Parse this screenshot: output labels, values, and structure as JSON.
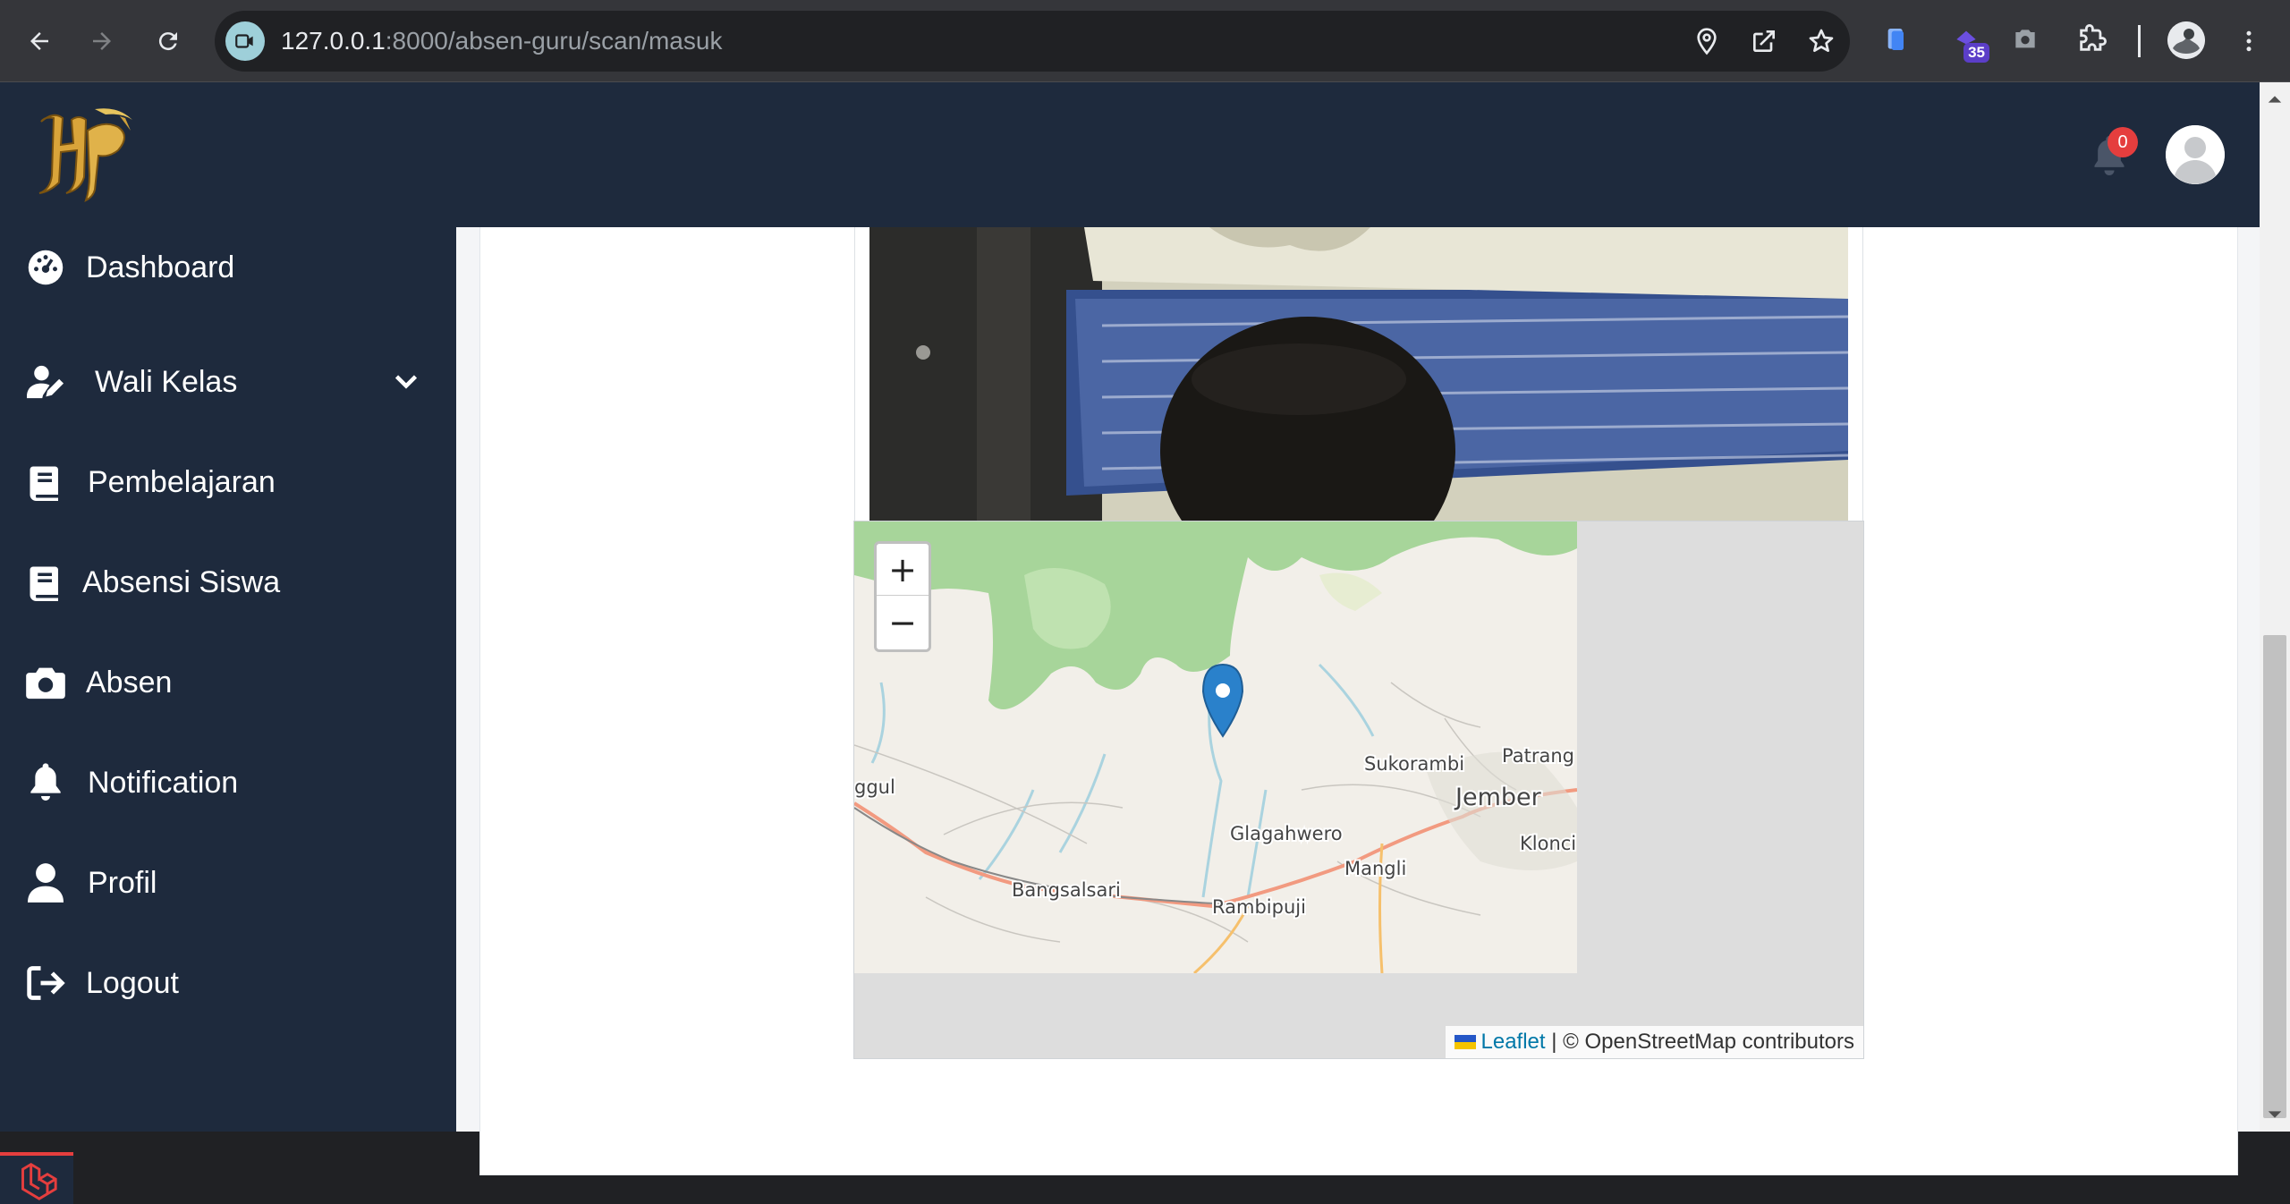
{
  "browser": {
    "url_host": "127.0.0.1",
    "url_rest": ":8000/absen-guru/scan/masuk",
    "extension_badge": "35",
    "icons": [
      "back-icon",
      "forward-icon",
      "reload-icon",
      "site-info-icon",
      "location-icon",
      "open-in-new-icon",
      "bookmark-star-icon",
      "extension-icon",
      "camera-icon",
      "puzzle-icon",
      "profile-icon",
      "more-icon"
    ]
  },
  "header": {
    "notification_count": "0"
  },
  "sidebar": {
    "items": [
      {
        "label": "Dashboard",
        "icon": "dashboard-icon"
      },
      {
        "label": "Wali Kelas",
        "icon": "user-edit-icon"
      },
      {
        "label": "Pembelajaran",
        "icon": "book-icon"
      },
      {
        "label": "Absensi Siswa",
        "icon": "book-icon"
      },
      {
        "label": "Absen",
        "icon": "camera-icon"
      },
      {
        "label": "Notification",
        "icon": "bell-icon"
      },
      {
        "label": "Profil",
        "icon": "user-icon"
      },
      {
        "label": "Logout",
        "icon": "logout-icon"
      }
    ]
  },
  "map": {
    "zoom_in": "+",
    "zoom_out": "−",
    "places": [
      "Sukorambi",
      "Patrang",
      "Jember",
      "Glagahwero",
      "Mangli",
      "Klonci",
      "Bangsalsari",
      "Rambipuji",
      "ggul"
    ],
    "attribution_link": "Leaflet",
    "attribution_text": " | © OpenStreetMap contributors",
    "colors": {
      "forest": "#a7d59a",
      "land": "#f2efe9",
      "road": "#f29a80",
      "water": "#aad3df"
    }
  },
  "colors": {
    "sidebar": "#1e2a3d",
    "badge": "#e53e3e",
    "marker": "#2a81cb"
  }
}
